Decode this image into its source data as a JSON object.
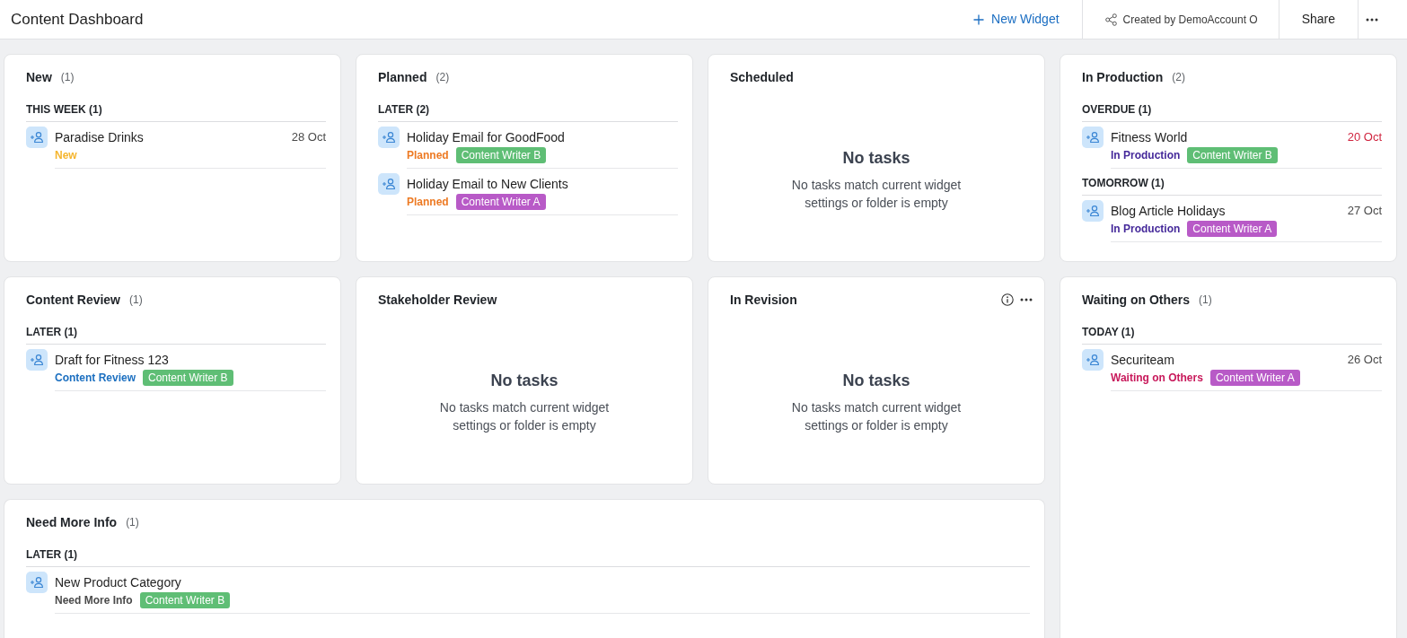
{
  "header": {
    "title": "Content Dashboard",
    "new_widget": "New Widget",
    "created_by": "Created by DemoAccount O",
    "share": "Share"
  },
  "widgets": [
    {
      "title": "New",
      "count": "(1)",
      "kind": "list",
      "actions": false,
      "groups": [
        {
          "label": "THIS WEEK (1)",
          "tasks": [
            {
              "title": "Paradise Drinks",
              "date": "28 Oct",
              "overdue": false,
              "status": {
                "label": "New",
                "color": "#f5b52e"
              }
            }
          ]
        }
      ]
    },
    {
      "title": "Planned",
      "count": "(2)",
      "kind": "list",
      "actions": false,
      "groups": [
        {
          "label": "LATER (2)",
          "tasks": [
            {
              "title": "Holiday Email for GoodFood",
              "status": {
                "label": "Planned",
                "color": "#ed7a23"
              },
              "tag": {
                "label": "Content Writer B",
                "color": "#5fbe75"
              }
            },
            {
              "title": "Holiday Email to New Clients",
              "status": {
                "label": "Planned",
                "color": "#ed7a23"
              },
              "tag": {
                "label": "Content Writer A",
                "color": "#b85ac7"
              }
            }
          ]
        }
      ]
    },
    {
      "title": "Scheduled",
      "kind": "empty",
      "actions": false,
      "empty": {
        "heading": "No tasks",
        "message": "No tasks match current widget settings or folder is empty"
      }
    },
    {
      "title": "In Production",
      "count": "(2)",
      "kind": "list",
      "actions": false,
      "groups": [
        {
          "label": "OVERDUE (1)",
          "tasks": [
            {
              "title": "Fitness World",
              "date": "20 Oct",
              "overdue": true,
              "status": {
                "label": "In Production",
                "color": "#45299a"
              },
              "tag": {
                "label": "Content Writer B",
                "color": "#5fbe75"
              }
            }
          ]
        },
        {
          "label": "TOMORROW (1)",
          "tasks": [
            {
              "title": "Blog Article Holidays",
              "date": "27 Oct",
              "overdue": false,
              "status": {
                "label": "In Production",
                "color": "#45299a"
              },
              "tag": {
                "label": "Content Writer A",
                "color": "#b85ac7"
              }
            }
          ]
        }
      ]
    },
    {
      "title": "Content Review",
      "count": "(1)",
      "kind": "list",
      "actions": false,
      "groups": [
        {
          "label": "LATER (1)",
          "tasks": [
            {
              "title": "Draft for Fitness 123",
              "status": {
                "label": "Content Review",
                "color": "#1b6fc0"
              },
              "tag": {
                "label": "Content Writer B",
                "color": "#5fbe75"
              }
            }
          ]
        }
      ]
    },
    {
      "title": "Stakeholder Review",
      "kind": "empty",
      "actions": false,
      "empty": {
        "heading": "No tasks",
        "message": "No tasks match current widget settings or folder is empty"
      }
    },
    {
      "title": "In Revision",
      "kind": "empty",
      "actions": true,
      "empty": {
        "heading": "No tasks",
        "message": "No tasks match current widget settings or folder is empty"
      }
    },
    {
      "title": "Waiting on Others",
      "count": "(1)",
      "kind": "list",
      "actions": false,
      "groups": [
        {
          "label": "TODAY (1)",
          "tasks": [
            {
              "title": "Securiteam",
              "date": "26 Oct",
              "overdue": false,
              "status": {
                "label": "Waiting on Others",
                "color": "#c8195b"
              },
              "tag": {
                "label": "Content Writer A",
                "color": "#b85ac7"
              }
            }
          ]
        }
      ]
    },
    {
      "title": "Need More Info",
      "count": "(1)",
      "kind": "list",
      "actions": false,
      "groups": [
        {
          "label": "LATER (1)",
          "tasks": [
            {
              "title": "New Product Category",
              "status": {
                "label": "Need More Info",
                "color": "#4a4a4a"
              },
              "tag": {
                "label": "Content Writer B",
                "color": "#5fbe75"
              }
            }
          ]
        }
      ]
    }
  ]
}
